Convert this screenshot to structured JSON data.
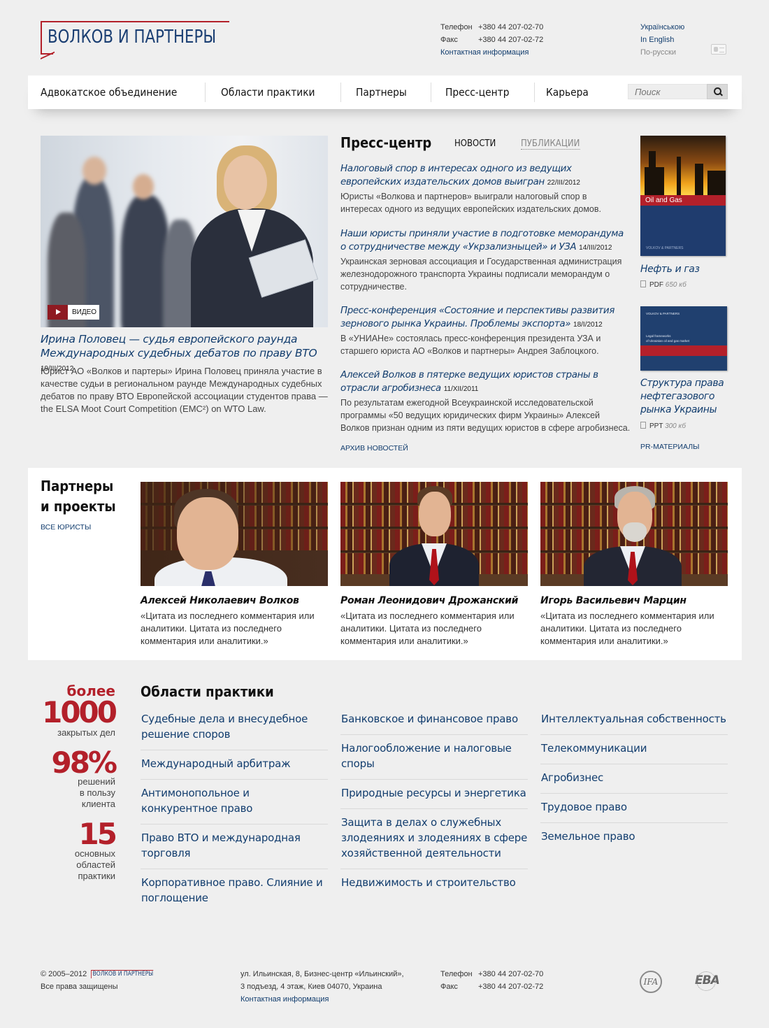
{
  "header": {
    "logo_text": "ВОЛКОВ И ПАРТНЕРЫ",
    "phone_label": "Телефон",
    "phone_value": "+380 44 207-02-70",
    "fax_label": "Факс",
    "fax_value": "+380 44 207-02-72",
    "contact_link": "Контактная информация",
    "languages": [
      "Українською",
      "In English",
      "По-русски"
    ],
    "vcard_icon": "vcard-icon"
  },
  "nav": {
    "items": [
      "Адвокатское объединение",
      "Области практики",
      "Партнеры",
      "Пресс-центр",
      "Карьера"
    ],
    "search_placeholder": "Поиск",
    "search_icon": "magnifier-icon"
  },
  "hero": {
    "video_label": "ВИДЕО",
    "title": "Ирина Половец — судья европейского раунда Международных судебных дебатов по праву ВТО",
    "date": "19/III/2012",
    "text": "Юрист АО «Волков и партеры» Ирина Половец приняла участие в качестве судьи в региональном раунде Международных судебных дебатов по праву ВТО Европейской ассоциации студентов права — the ELSA Moot Court Competition (EMC²) on WTO Law."
  },
  "press": {
    "heading": "Пресс-центр",
    "tab_news": "НОВОСТИ",
    "tab_pubs": "ПУБЛИКАЦИИ",
    "news": [
      {
        "title": "Налоговый спор в интересах одного из ведущих европейских издательских домов выигран",
        "date": "22/III/2012",
        "text": "Юристы «Волкова и партнеров» выиграли налоговый спор в интересах одного из ведущих европейских издательских домов."
      },
      {
        "title": "Наши юристы приняли участие в подготовке меморандума о сотрудничестве между «Укрзализныцей» и УЗА",
        "date": "14/III/2012",
        "text": "Украинская зерновая ассоциация и Государственная администрация железнодорожного транспорта Украины подписали меморандум о сотрудничестве."
      },
      {
        "title": "Пресс-конференция «Состояние и перспективы развития зернового рынка Украины. Проблемы экспорта»",
        "date": "18/I/2012",
        "text": "В «УНИАНе» состоялась пресс-конференция президента УЗА и старшего юриста АО «Волков и партнеры» Андрея Заблоцкого."
      },
      {
        "title": "Алексей Волков в пятерке ведущих юристов страны в отрасли агробизнеса",
        "date": "11/XII/2011",
        "text": "По результатам ежегодной Всеукраинской исследовательской программы «50 ведущих юридических фирм Украины» Алексей Волков признан одним из пяти ведущих юристов в сфере агробизнеса."
      }
    ],
    "archive": "АРХИВ НОВОСТЕЙ"
  },
  "materials": {
    "book1_band": "Oil and Gas",
    "book1_brand": "VOLKOV & PARTNERS",
    "book1_title": "Нефть и газ",
    "book1_type": "PDF",
    "book1_size": "650 кб",
    "book2_brand": "VOLKOV & PARTNERS",
    "book2_line1": "Legal frameworks",
    "book2_line2": "of Ukrainian oil and gas market",
    "book2_title": "Структура права нефтегазового рынка Украины",
    "book2_type": "PPT",
    "book2_size": "300 кб",
    "pr_link": "PR-МАТЕРИАЛЫ"
  },
  "partners": {
    "heading_line1": "Партнеры",
    "heading_line2": "и проекты",
    "all_link": "ВСЕ ЮРИСТЫ",
    "people": [
      {
        "name": "Алексей Николаевич Волков",
        "quote": "«Цитата из последнего комментария или аналитики. Цитата из последнего комментария или аналитики.»"
      },
      {
        "name": "Роман Леонидович Дрожанский",
        "quote": "«Цитата из последнего комментария или аналитики. Цитата из последнего комментария или аналитики.»"
      },
      {
        "name": "Игорь Васильевич Марцин",
        "quote": "«Цитата из последнего комментария или аналитики. Цитата из последнего комментария или аналитики.»"
      }
    ]
  },
  "stats": {
    "s1_prefix": "более",
    "s1_value": "1000",
    "s1_label": "закрытых дел",
    "s2_value": "98%",
    "s2_label_1": "решений",
    "s2_label_2": "в пользу",
    "s2_label_3": "клиента",
    "s3_value": "15",
    "s3_label_1": "основных",
    "s3_label_2": "областей",
    "s3_label_3": "практики"
  },
  "practice": {
    "heading": "Области практики",
    "col1": [
      "Судебные дела и внесудебное решение споров",
      "Международный арбитраж",
      "Антимонопольное и конкурентное право",
      "Право ВТО и международная торговля",
      "Корпоративное право. Слияние и поглощение"
    ],
    "col2": [
      "Банковское и финансовое право",
      "Налогообложение и налоговые споры",
      "Природные ресурсы и энергетика",
      "Защита в делах о служебных злодеяниях и злодеяниях в сфере хозяйственной деятельности",
      "Недвижимость и строительство"
    ],
    "col3": [
      "Интеллектуальная собственность",
      "Телекоммуникации",
      "Агробизнес",
      "Трудовое право",
      "Земельное право"
    ]
  },
  "footer": {
    "copyright": "© 2005–2012",
    "mini_logo": "ВОЛКОВ И ПАРТНЕРЫ",
    "rights": "Все права защищены",
    "address_1": "ул. Ильинская, 8, Бизнес-центр «Ильинский»,",
    "address_2": "3 подъезд, 4 этаж, Киев 04070, Украина",
    "contact_link": "Контактная информация",
    "phone_label": "Телефон",
    "phone_value": "+380 44 207-02-70",
    "fax_label": "Факс",
    "fax_value": "+380 44 207-02-72",
    "ifa_logo": "IFA",
    "eba_logo": "EBA"
  }
}
